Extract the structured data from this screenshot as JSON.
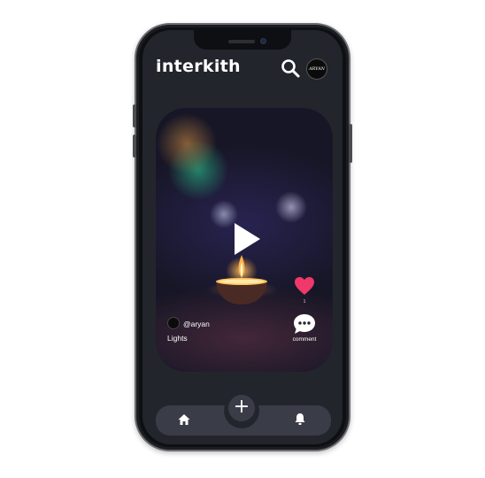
{
  "app": {
    "name": "interkith"
  },
  "header": {
    "avatar_text": "ARYAN",
    "search_icon": "search-icon"
  },
  "video": {
    "creator_handle": "@aryan",
    "caption": "Lights",
    "likes": "1",
    "comment_label": "comment"
  },
  "nav": {
    "add_label": "+",
    "home_icon": "home-icon",
    "bell_icon": "bell-icon"
  },
  "colors": {
    "screen_bg": "#23252d",
    "nav_bg": "#3a3d47",
    "heart": "#f0386b",
    "flame": "#ffb347"
  }
}
